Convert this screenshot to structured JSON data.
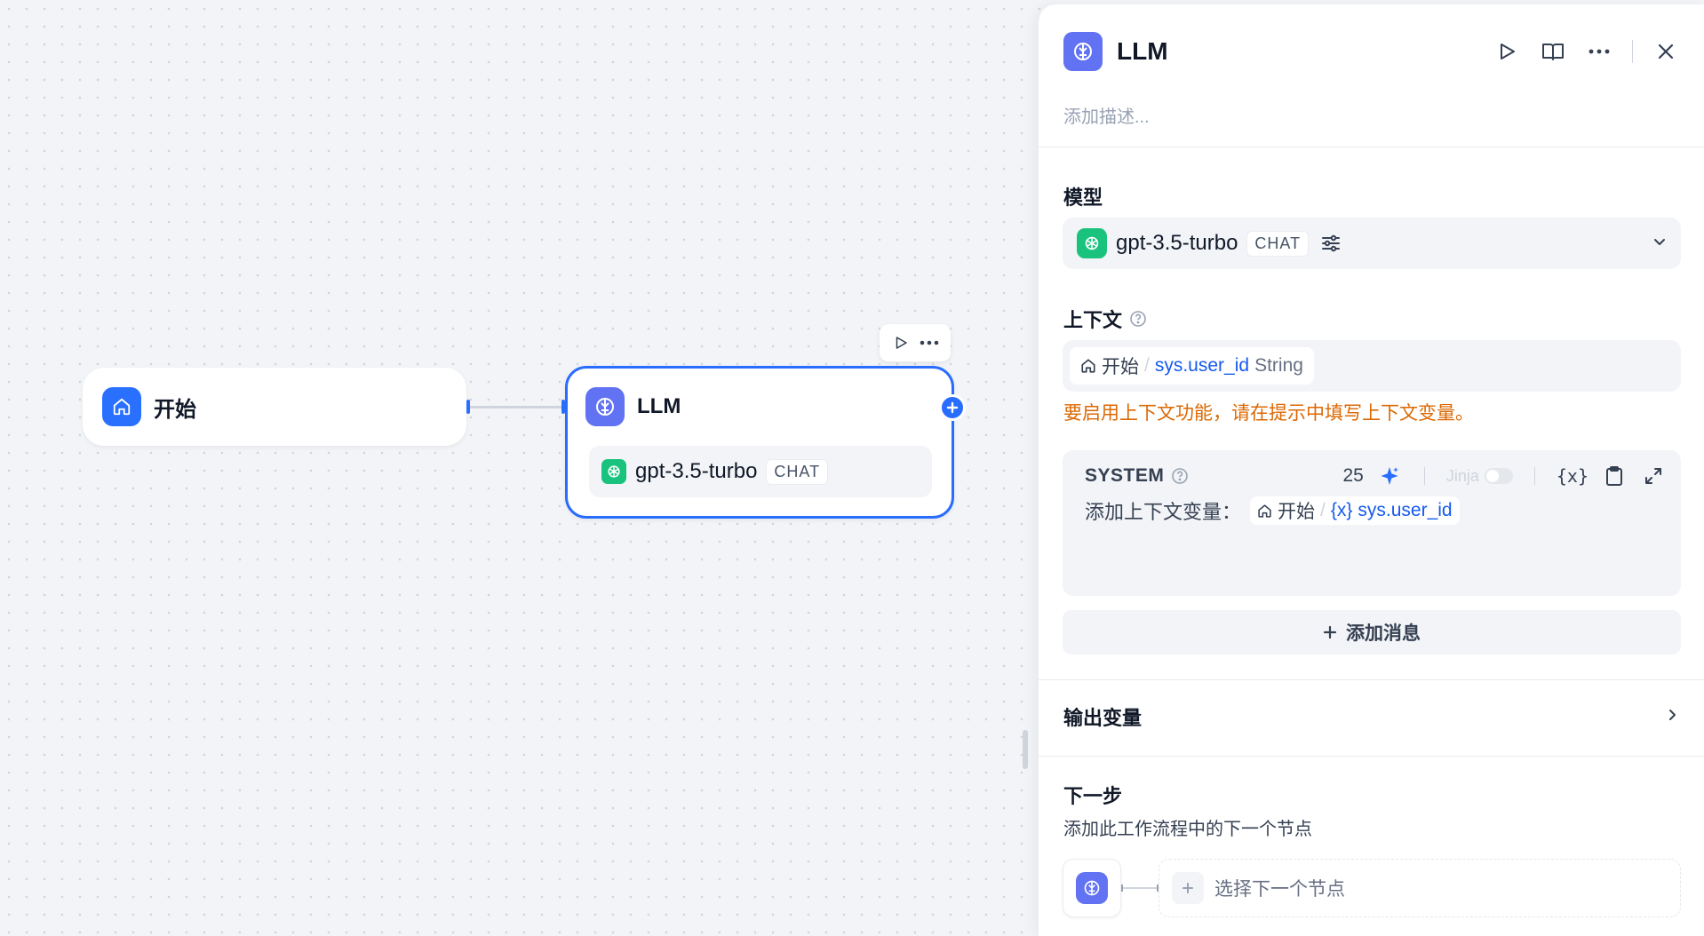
{
  "canvas": {
    "start_node": {
      "title": "开始",
      "icon": "home-icon"
    },
    "llm_node": {
      "title": "LLM",
      "icon": "brain-icon",
      "model": "gpt-3.5-turbo",
      "model_tag": "CHAT"
    },
    "toolbar": {
      "icons": [
        "play-icon",
        "more-icon"
      ]
    }
  },
  "panel": {
    "title": "LLM",
    "description_placeholder": "添加描述...",
    "header_icons": [
      "play-icon",
      "book-icon",
      "more-icon",
      "close-icon"
    ],
    "model_section": {
      "label": "模型",
      "model": "gpt-3.5-turbo",
      "tag": "CHAT"
    },
    "context_section": {
      "label": "上下文",
      "variable": {
        "node": "开始",
        "separator": "/",
        "name": "sys.user_id",
        "type": "String"
      },
      "warning": "要启用上下文功能，请在提示中填写上下文变量。"
    },
    "prompt": {
      "role": "SYSTEM",
      "token_count": "25",
      "jinja_label": "Jinja",
      "jinja_enabled": false,
      "var_symbol": "{x}",
      "text": "添加上下文变量：",
      "variable": {
        "node": "开始",
        "separator": "/",
        "symbol": "{x}",
        "name": "sys.user_id"
      }
    },
    "add_message_label": "添加消息",
    "output_section": {
      "label": "输出变量"
    },
    "next_step": {
      "label": "下一步",
      "description": "添加此工作流程中的下一个节点",
      "select_placeholder": "选择下一个节点"
    }
  },
  "colors": {
    "accent": "#296dff",
    "start_icon_bg": "#2970ff",
    "llm_icon_bg": "#6172f3",
    "openai_green": "#19c37d",
    "warning": "#dc6803",
    "variable_text": "#155aef"
  }
}
